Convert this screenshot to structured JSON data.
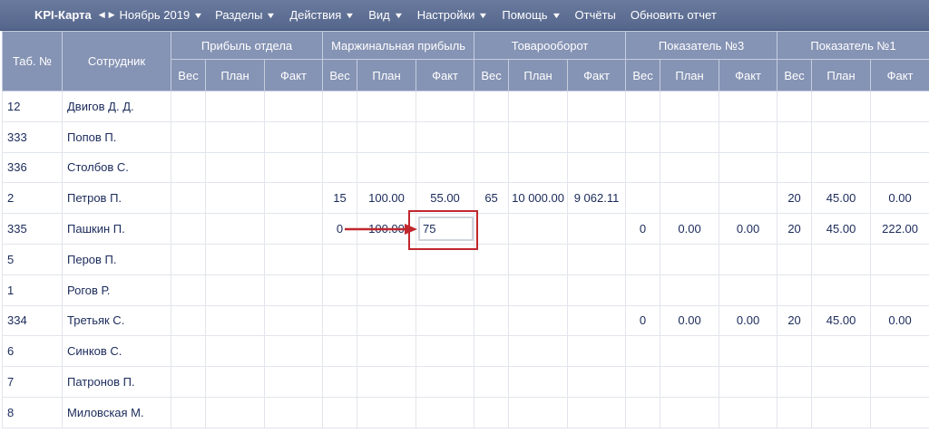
{
  "menu": {
    "brand": "KPI-Карта",
    "month": "Ноябрь 2019",
    "items": [
      {
        "label": "Разделы",
        "dropdown": true
      },
      {
        "label": "Действия",
        "dropdown": true
      },
      {
        "label": "Вид",
        "dropdown": true
      },
      {
        "label": "Настройки",
        "dropdown": true
      },
      {
        "label": "Помощь",
        "dropdown": true
      },
      {
        "label": "Отчёты",
        "dropdown": false
      },
      {
        "label": "Обновить отчет",
        "dropdown": false
      }
    ]
  },
  "table": {
    "col_tab": "Таб. №",
    "col_employee": "Сотрудник",
    "groups": [
      "Прибыль отдела",
      "Маржинальная прибыль",
      "Товарооборот",
      "Показатель №3",
      "Показатель №1"
    ],
    "sub": [
      "Вес",
      "План",
      "Факт"
    ],
    "rows": [
      {
        "tab": "12",
        "name": "Двигов Д. Д.",
        "cells": [
          "",
          "",
          "",
          "",
          "",
          "",
          "",
          "",
          "",
          "",
          "",
          "",
          "",
          "",
          ""
        ]
      },
      {
        "tab": "333",
        "name": "Попов П.",
        "cells": [
          "",
          "",
          "",
          "",
          "",
          "",
          "",
          "",
          "",
          "",
          "",
          "",
          "",
          "",
          ""
        ]
      },
      {
        "tab": "336",
        "name": "Столбов С.",
        "cells": [
          "",
          "",
          "",
          "",
          "",
          "",
          "",
          "",
          "",
          "",
          "",
          "",
          "",
          "",
          ""
        ]
      },
      {
        "tab": "2",
        "name": "Петров П.",
        "cells": [
          "",
          "",
          "",
          "15",
          "100.00",
          "55.00",
          "65",
          "10 000.00",
          "9 062.11",
          "",
          "",
          "",
          "20",
          "45.00",
          "0.00"
        ]
      },
      {
        "tab": "335",
        "name": "Пашкин П.",
        "cells": [
          "",
          "",
          "",
          "0",
          "100.00",
          "",
          "",
          "",
          "",
          "0",
          "0.00",
          "0.00",
          "20",
          "45.00",
          "222.00"
        ]
      },
      {
        "tab": "5",
        "name": "Перов П.",
        "cells": [
          "",
          "",
          "",
          "",
          "",
          "",
          "",
          "",
          "",
          "",
          "",
          "",
          "",
          "",
          ""
        ]
      },
      {
        "tab": "1",
        "name": "Рогов Р.",
        "cells": [
          "",
          "",
          "",
          "",
          "",
          "",
          "",
          "",
          "",
          "",
          "",
          "",
          "",
          "",
          ""
        ]
      },
      {
        "tab": "334",
        "name": "Третьяк С.",
        "cells": [
          "",
          "",
          "",
          "",
          "",
          "",
          "",
          "",
          "",
          "0",
          "0.00",
          "0.00",
          "20",
          "45.00",
          "0.00"
        ]
      },
      {
        "tab": "6",
        "name": "Синков С.",
        "cells": [
          "",
          "",
          "",
          "",
          "",
          "",
          "",
          "",
          "",
          "",
          "",
          "",
          "",
          "",
          ""
        ]
      },
      {
        "tab": "7",
        "name": "Патронов П.",
        "cells": [
          "",
          "",
          "",
          "",
          "",
          "",
          "",
          "",
          "",
          "",
          "",
          "",
          "",
          "",
          ""
        ]
      },
      {
        "tab": "8",
        "name": "Миловская М.",
        "cells": [
          "",
          "",
          "",
          "",
          "",
          "",
          "",
          "",
          "",
          "",
          "",
          "",
          "",
          "",
          ""
        ]
      }
    ]
  },
  "editing": {
    "row": 4,
    "col": 5,
    "value": "75"
  },
  "colors": {
    "header_bg": "#8593b4",
    "menubar_bg": "#5e6e93",
    "text": "#1a2a5a",
    "annotation": "#c0272d"
  }
}
